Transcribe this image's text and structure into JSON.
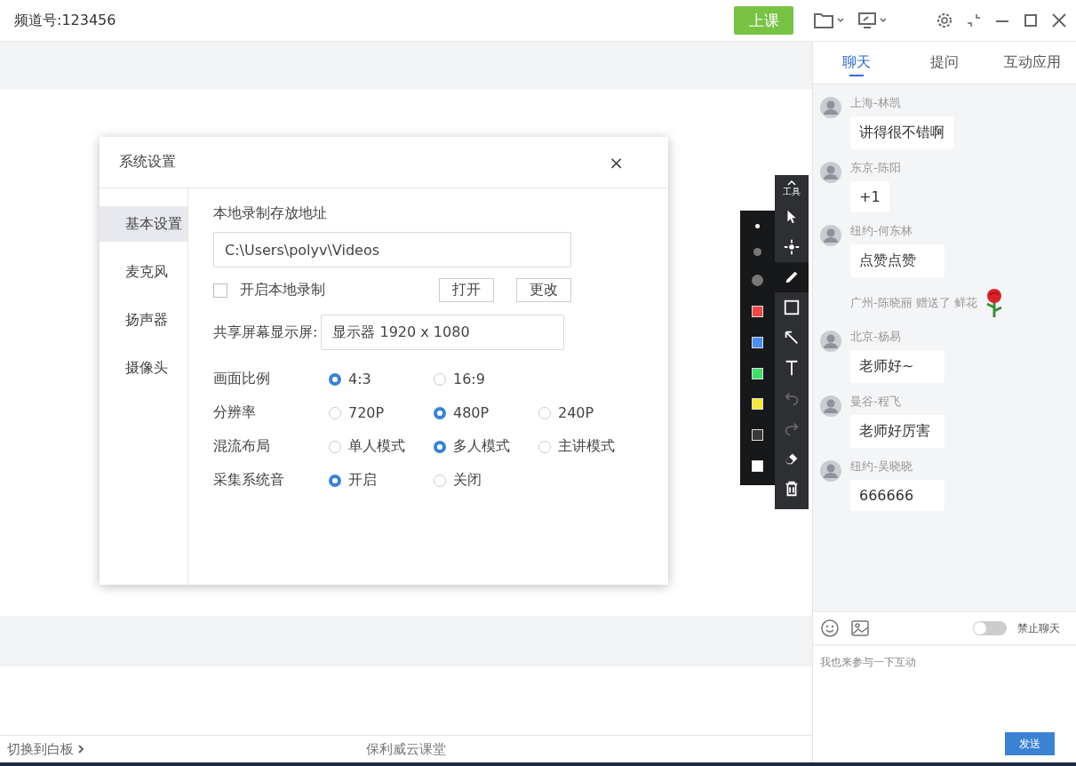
{
  "top_bar": {
    "title": "频道号:123456",
    "start_button": "上课"
  },
  "settings_dialog": {
    "title": "系统设置",
    "close": "×",
    "nav": [
      {
        "label": "基本设置",
        "selected": true
      },
      {
        "label": "麦克风",
        "selected": false
      },
      {
        "label": "扬声器",
        "selected": false
      },
      {
        "label": "摄像头",
        "selected": false
      }
    ],
    "record_path": {
      "label": "本地录制存放地址",
      "value": "C:\\Users\\polyv\\Videos"
    },
    "local_record": {
      "label": "开启本地录制",
      "checked": false
    },
    "buttons": [
      "打开",
      "更改"
    ],
    "screen": {
      "label": "共享屏幕显示屏:",
      "value": "显示器  1920 x 1080"
    },
    "options": [
      {
        "label": "画面比例",
        "choices": [
          {
            "label": "4:3",
            "selected": true
          },
          {
            "label": "16:9",
            "selected": false
          }
        ]
      },
      {
        "label": "分辨率",
        "choices": [
          {
            "label": "720P",
            "selected": false
          },
          {
            "label": "480P",
            "selected": true
          },
          {
            "label": "240P",
            "selected": false
          }
        ]
      },
      {
        "label": "混流布局",
        "choices": [
          {
            "label": "单人模式",
            "selected": false
          },
          {
            "label": "多人模式",
            "selected": true
          },
          {
            "label": "主讲模式",
            "selected": false
          }
        ]
      },
      {
        "label": "采集系统音",
        "choices": [
          {
            "label": "开启",
            "selected": true
          },
          {
            "label": "关闭",
            "selected": false
          }
        ]
      }
    ]
  },
  "whiteboard_tools": {
    "label": "工具",
    "tools": [
      {
        "kind": "select",
        "selected": false,
        "disabled": false
      },
      {
        "kind": "laser",
        "selected": false,
        "disabled": false
      },
      {
        "kind": "pen",
        "selected": true,
        "disabled": false
      },
      {
        "kind": "rectangle",
        "selected": false,
        "disabled": false
      },
      {
        "kind": "arrow",
        "selected": false,
        "disabled": false
      },
      {
        "kind": "text",
        "selected": false,
        "disabled": false
      },
      {
        "kind": "undo",
        "selected": false,
        "disabled": true
      },
      {
        "kind": "redo",
        "selected": false,
        "disabled": true
      },
      {
        "kind": "eraser",
        "selected": false,
        "disabled": false
      },
      {
        "kind": "delete",
        "selected": false,
        "disabled": false
      }
    ],
    "palette": [
      {
        "kind": "small",
        "selected": true
      },
      {
        "kind": "medium",
        "selected": false
      },
      {
        "kind": "large",
        "selected": false
      },
      {
        "kind": "color",
        "color": "#f04848"
      },
      {
        "kind": "color",
        "color": "#4a8ef0"
      },
      {
        "kind": "color",
        "color": "#3ee06a"
      },
      {
        "kind": "color",
        "color": "#f5ea3a"
      },
      {
        "kind": "color",
        "color": "#3a3a3a"
      },
      {
        "kind": "color",
        "color": "#ffffff"
      }
    ]
  },
  "chat": {
    "tabs": [
      {
        "label": "聊天",
        "selected": true
      },
      {
        "label": "提问",
        "selected": false
      },
      {
        "label": "互动应用",
        "selected": false
      }
    ],
    "messages": [
      {
        "kind": "message",
        "name": "上海-林凯",
        "text": "讲得很不错啊"
      },
      {
        "kind": "message",
        "name": "东京-陈阳",
        "text": "+1"
      },
      {
        "kind": "message",
        "name": "纽约-何东林",
        "text": "点赞点赞"
      },
      {
        "kind": "gift",
        "text": "广州-陈晓丽 赠送了 鲜花"
      },
      {
        "kind": "message",
        "name": "北京-杨易",
        "text": "老师好~"
      },
      {
        "kind": "message",
        "name": "曼谷-程飞",
        "text": "老师好厉害"
      },
      {
        "kind": "message",
        "name": "纽约-吴晓晓",
        "text": "666666"
      }
    ],
    "mute_chat": {
      "label": "禁止聊天",
      "on": false
    },
    "input": {
      "placeholder": "我也来参与一下互动"
    },
    "send_button": "发送"
  },
  "footer": {
    "switch_link": "切换到白板",
    "brand": "保利威云课堂"
  }
}
